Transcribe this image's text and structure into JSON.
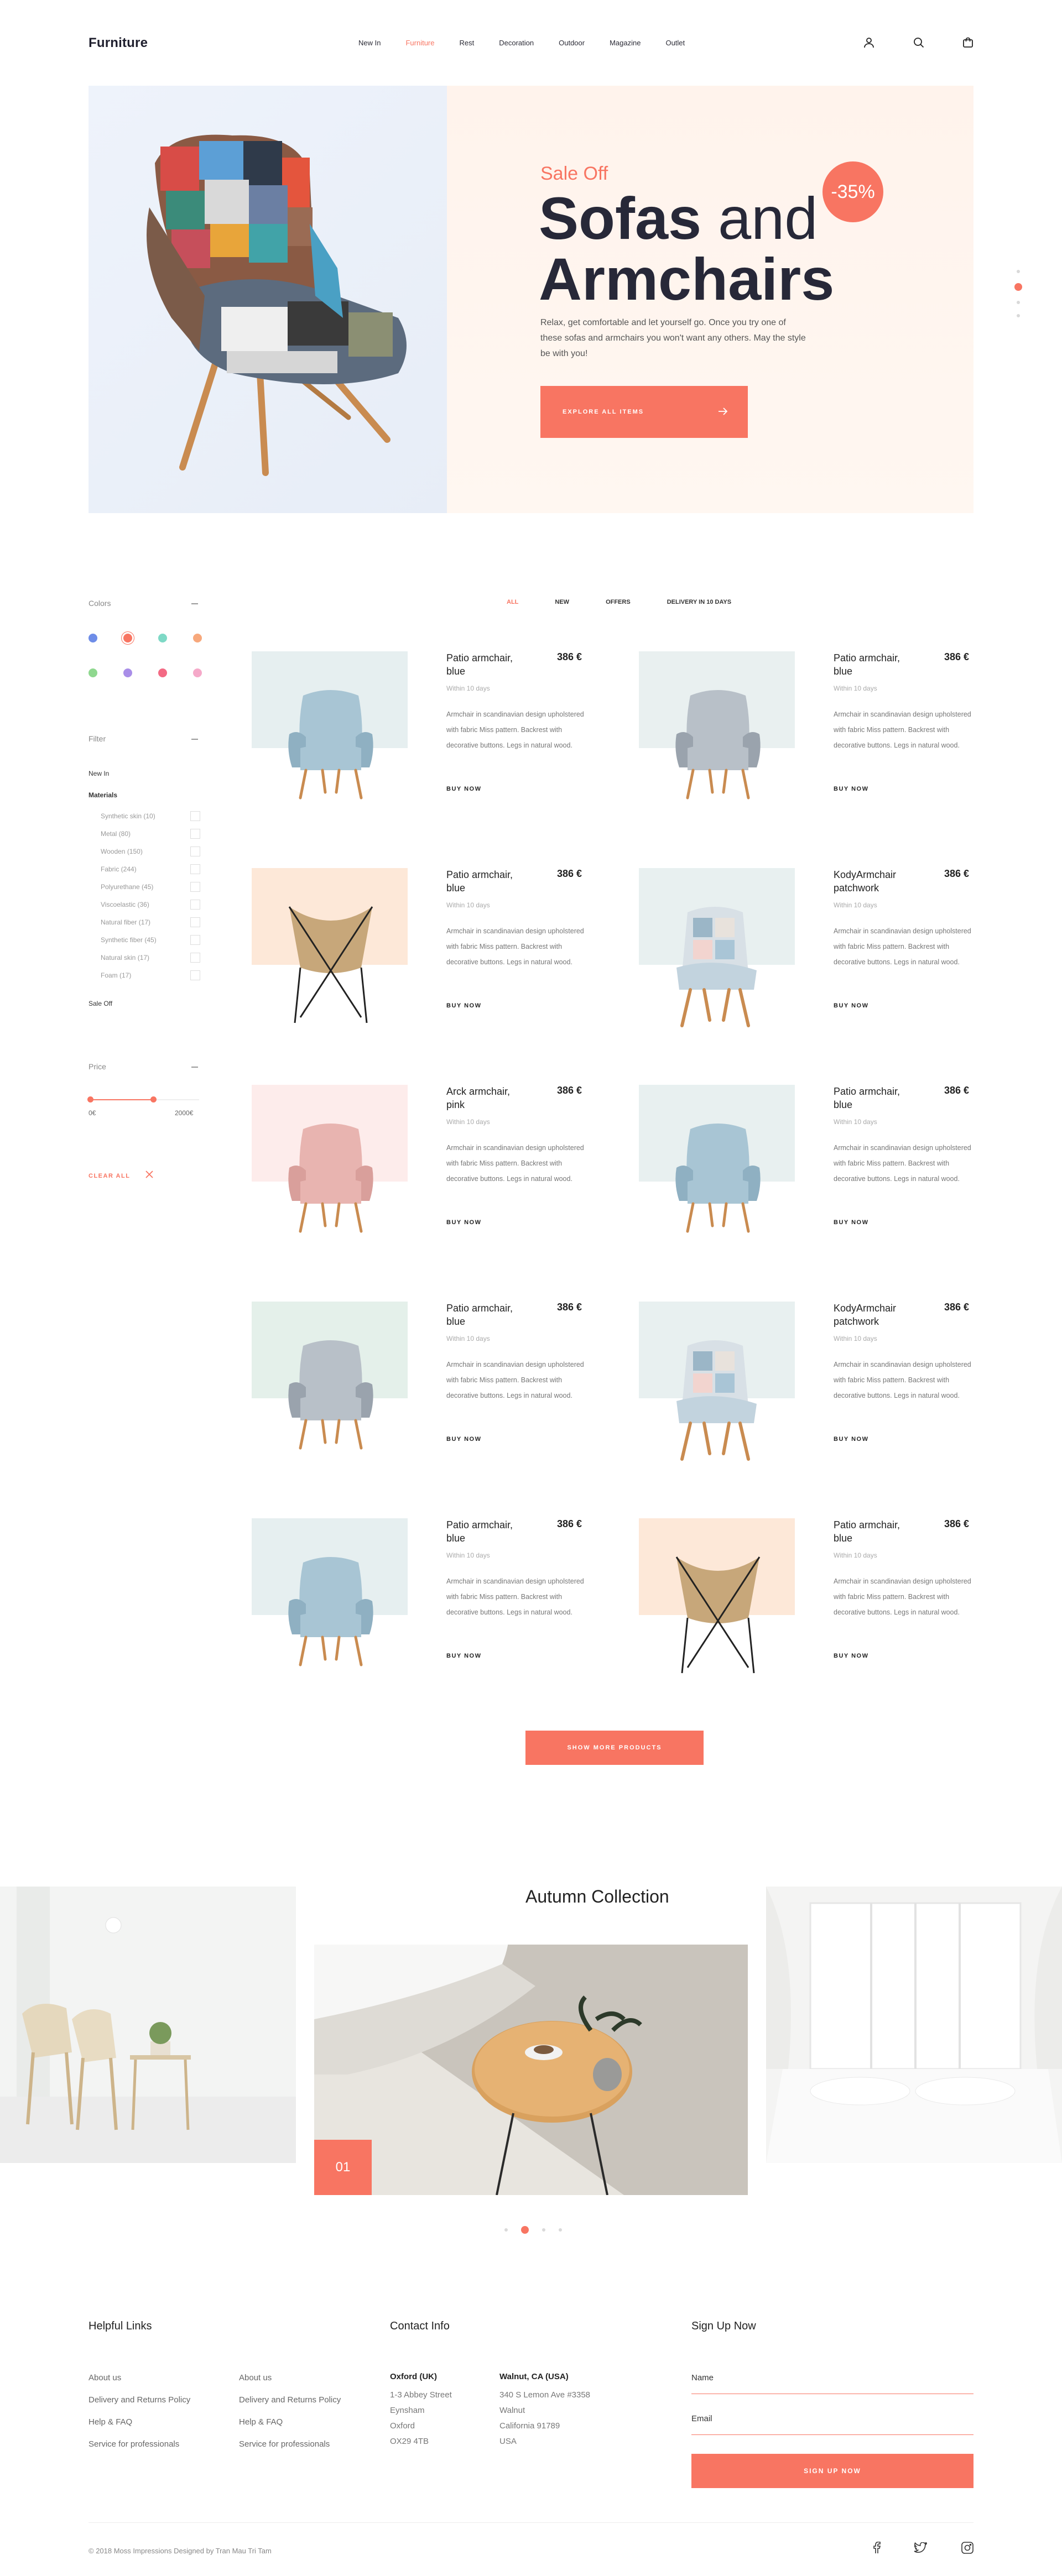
{
  "header": {
    "logo": "Furniture",
    "nav": [
      "New In",
      "Furniture",
      "Rest",
      "Decoration",
      "Outdoor",
      "Magazine",
      "Outlet"
    ],
    "active_nav": "Furniture"
  },
  "hero": {
    "sale": "Sale Off",
    "title_bold_1": "Sofas",
    "title_light": " and",
    "title_bold_2": "Armchairs",
    "description": "Relax, get comfortable and let yourself go. Once you try one of these sofas and armchairs you won't want any others. May the style be with you!",
    "badge": "-35%",
    "button": "EXPLORE ALL ITEMS"
  },
  "sidebar": {
    "colors_title": "Colors",
    "swatches": [
      "#6e8de8",
      "#f87562",
      "#7ed9c6",
      "#f7a87c",
      "#8fd88f",
      "#a98ee8",
      "#f36a84",
      "#f5a9c9"
    ],
    "filter_title": "Filter",
    "new_in": "New In",
    "materials_title": "Materials",
    "materials": [
      "Synthetic skin (10)",
      "Metal (80)",
      "Wooden (150)",
      "Fabric (244)",
      "Polyurethane (45)",
      "Viscoelastic (36)",
      "Natural fiber (17)",
      "Synthetic fiber (45)",
      "Natural skin (17)",
      "Foam (17)"
    ],
    "sale_off": "Sale Off",
    "price_title": "Price",
    "price_min": "0€",
    "price_max": "2000€",
    "clear_all": "CLEAR ALL"
  },
  "tabs": [
    "ALL",
    "NEW",
    "OFFERS",
    "DELIVERY IN 10 DAYS"
  ],
  "products": [
    {
      "name": "Patio armchair, blue",
      "price": "386 €",
      "sub": "Within 10 days",
      "desc": "Armchair in scandinavian design upholstered with fabric Miss pattern. Backrest with decorative buttons. Legs in natural wood.",
      "buy": "BUY NOW"
    },
    {
      "name": "Patio armchair, blue",
      "price": "386 €",
      "sub": "Within 10 days",
      "desc": "Armchair in scandinavian design upholstered with fabric Miss pattern. Backrest with decorative buttons. Legs in natural wood.",
      "buy": "BUY NOW"
    },
    {
      "name": "Patio armchair, blue",
      "price": "386 €",
      "sub": "Within 10 days",
      "desc": "Armchair in scandinavian design upholstered with fabric Miss pattern. Backrest with decorative buttons. Legs in natural wood.",
      "buy": "BUY NOW"
    },
    {
      "name": "KodyArmchair patchwork",
      "price": "386 €",
      "sub": "Within 10 days",
      "desc": "Armchair in scandinavian design upholstered with fabric Miss pattern. Backrest with decorative buttons. Legs in natural wood.",
      "buy": "BUY NOW"
    },
    {
      "name": "Arck armchair, pink",
      "price": "386 €",
      "sub": "Within 10 days",
      "desc": "Armchair in scandinavian design upholstered with fabric Miss pattern. Backrest with decorative buttons. Legs in natural wood.",
      "buy": "BUY NOW"
    },
    {
      "name": "Patio armchair, blue",
      "price": "386 €",
      "sub": "Within 10 days",
      "desc": "Armchair in scandinavian design upholstered with fabric Miss pattern. Backrest with decorative buttons. Legs in natural wood.",
      "buy": "BUY NOW"
    },
    {
      "name": "Patio armchair, blue",
      "price": "386 €",
      "sub": "Within 10 days",
      "desc": "Armchair in scandinavian design upholstered with fabric Miss pattern. Backrest with decorative buttons. Legs in natural wood.",
      "buy": "BUY NOW"
    },
    {
      "name": "KodyArmchair patchwork",
      "price": "386 €",
      "sub": "Within 10 days",
      "desc": "Armchair in scandinavian design upholstered with fabric Miss pattern. Backrest with decorative buttons. Legs in natural wood.",
      "buy": "BUY NOW"
    },
    {
      "name": "Patio armchair, blue",
      "price": "386 €",
      "sub": "Within 10 days",
      "desc": "Armchair in scandinavian design upholstered with fabric Miss pattern. Backrest with decorative buttons. Legs in natural wood.",
      "buy": "BUY NOW"
    },
    {
      "name": "Patio armchair, blue",
      "price": "386 €",
      "sub": "Within 10 days",
      "desc": "Armchair in scandinavian design upholstered with fabric Miss pattern. Backrest with decorative buttons. Legs in natural wood.",
      "buy": "BUY NOW"
    }
  ],
  "product_bg_colors": [
    "#e6eff0",
    "#e9f0f0",
    "#fde8d8",
    "#e8f0f0",
    "#fdeceb",
    "#e8f0f0",
    "#e4f0ea",
    "#e8f0f0",
    "#e6eff0",
    "#fde8d8"
  ],
  "more_button": "SHOW MORE PRODUCTS",
  "collection": {
    "title": "Autumn Collection",
    "number": "01"
  },
  "footer": {
    "helpful_title": "Helpful Links",
    "links_col1": [
      "About us",
      "Delivery and Returns Policy",
      "Help & FAQ",
      "Service for professionals"
    ],
    "links_col2": [
      "About us",
      "Delivery and Returns Policy",
      "Help & FAQ",
      "Service for professionals"
    ],
    "contact_title": "Contact Info",
    "office1_name": "Oxford (UK)",
    "office1_lines": [
      "1-3 Abbey Street",
      "Eynsham",
      "Oxford",
      "OX29 4TB"
    ],
    "office2_name": "Walnut, CA (USA)",
    "office2_lines": [
      "340 S Lemon Ave #3358",
      "Walnut",
      "California 91789",
      "USA"
    ],
    "signup_title": "Sign Up Now",
    "name_label": "Name",
    "email_label": "Email",
    "signup_button": "SIGN UP NOW",
    "copyright": "© 2018 Moss Impressions Designed by Tran Mau Tri Tam"
  }
}
